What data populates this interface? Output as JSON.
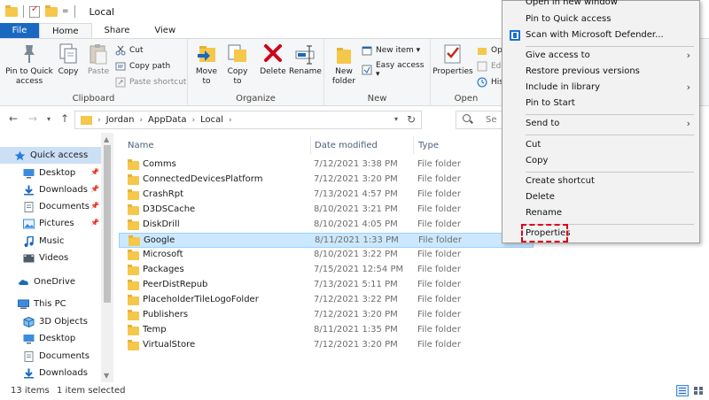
{
  "titlebar": {
    "title": "Local",
    "qa_dropdown": "="
  },
  "tabs": [
    {
      "label": "File"
    },
    {
      "label": "Home"
    },
    {
      "label": "Share"
    },
    {
      "label": "View"
    }
  ],
  "ribbon": {
    "clipboard": {
      "label": "Clipboard",
      "pin_quick_access": "Pin to Quick access",
      "copy": "Copy",
      "paste": "Paste",
      "cut": "Cut",
      "copy_path": "Copy path",
      "paste_shortcut": "Paste shortcut"
    },
    "organize": {
      "label": "Organize",
      "move_to": "Move to",
      "copy_to": "Copy to",
      "delete": "Delete",
      "rename": "Rename"
    },
    "new": {
      "label": "New",
      "new_folder": "New folder",
      "new_item": "New item ▾",
      "easy_access": "Easy access ▾"
    },
    "open": {
      "label": "Open",
      "properties": "Properties",
      "open_partial": "Op",
      "edit_partial": "Edi",
      "history_partial": "His"
    }
  },
  "address": {
    "crumbs": [
      "Jordan",
      "AppData",
      "Local"
    ],
    "search_placeholder": "Se"
  },
  "navpane": {
    "items": [
      {
        "label": "Quick access",
        "icon": "star-icon",
        "selected": true
      },
      {
        "label": "Desktop",
        "icon": "desktop-icon",
        "pinned": true
      },
      {
        "label": "Downloads",
        "icon": "download-icon",
        "pinned": true
      },
      {
        "label": "Documents",
        "icon": "documents-icon",
        "pinned": true
      },
      {
        "label": "Pictures",
        "icon": "pictures-icon",
        "pinned": true
      },
      {
        "label": "Music",
        "icon": "music-icon"
      },
      {
        "label": "Videos",
        "icon": "videos-icon"
      },
      {
        "label": "OneDrive",
        "icon": "cloud-icon"
      },
      {
        "label": "This PC",
        "icon": "pc-icon"
      },
      {
        "label": "3D Objects",
        "icon": "cube-icon"
      },
      {
        "label": "Desktop",
        "icon": "desktop-icon"
      },
      {
        "label": "Documents",
        "icon": "documents-icon"
      },
      {
        "label": "Downloads",
        "icon": "download-icon"
      }
    ]
  },
  "content": {
    "columns": {
      "name": "Name",
      "date": "Date modified",
      "type": "Type"
    },
    "rows": [
      {
        "name": "Comms",
        "date": "7/12/2021 3:38 PM",
        "type": "File folder"
      },
      {
        "name": "ConnectedDevicesPlatform",
        "date": "7/12/2021 3:20 PM",
        "type": "File folder"
      },
      {
        "name": "CrashRpt",
        "date": "7/13/2021 4:57 PM",
        "type": "File folder"
      },
      {
        "name": "D3DSCache",
        "date": "8/10/2021 3:21 PM",
        "type": "File folder"
      },
      {
        "name": "DiskDrill",
        "date": "8/10/2021 4:05 PM",
        "type": "File folder"
      },
      {
        "name": "Google",
        "date": "8/11/2021 1:33 PM",
        "type": "File folder",
        "selected": true
      },
      {
        "name": "Microsoft",
        "date": "8/10/2021 3:22 PM",
        "type": "File folder"
      },
      {
        "name": "Packages",
        "date": "7/15/2021 12:54 PM",
        "type": "File folder"
      },
      {
        "name": "PeerDistRepub",
        "date": "7/13/2021 5:11 PM",
        "type": "File folder"
      },
      {
        "name": "PlaceholderTileLogoFolder",
        "date": "7/12/2021 3:22 PM",
        "type": "File folder"
      },
      {
        "name": "Publishers",
        "date": "7/12/2021 3:20 PM",
        "type": "File folder"
      },
      {
        "name": "Temp",
        "date": "8/11/2021 1:35 PM",
        "type": "File folder"
      },
      {
        "name": "VirtualStore",
        "date": "7/12/2021 3:20 PM",
        "type": "File folder"
      }
    ]
  },
  "status": {
    "count": "13 items",
    "selected": "1 item selected"
  },
  "context_menu": {
    "items": [
      {
        "label": "Open in new window"
      },
      {
        "label": "Pin to Quick access"
      },
      {
        "label": "Scan with Microsoft Defender..."
      },
      {
        "label": "Give access to"
      },
      {
        "label": "Restore previous versions"
      },
      {
        "label": "Include in library"
      },
      {
        "label": "Pin to Start"
      },
      {
        "label": "Send to"
      },
      {
        "label": "Cut"
      },
      {
        "label": "Copy"
      },
      {
        "label": "Create shortcut"
      },
      {
        "label": "Delete"
      },
      {
        "label": "Rename"
      },
      {
        "label": "Properties"
      }
    ],
    "highlight_color": "#e0001a"
  },
  "colors": {
    "accent": "#1a68c0",
    "selection": "#cce8ff",
    "folder": "#f5c74a"
  }
}
